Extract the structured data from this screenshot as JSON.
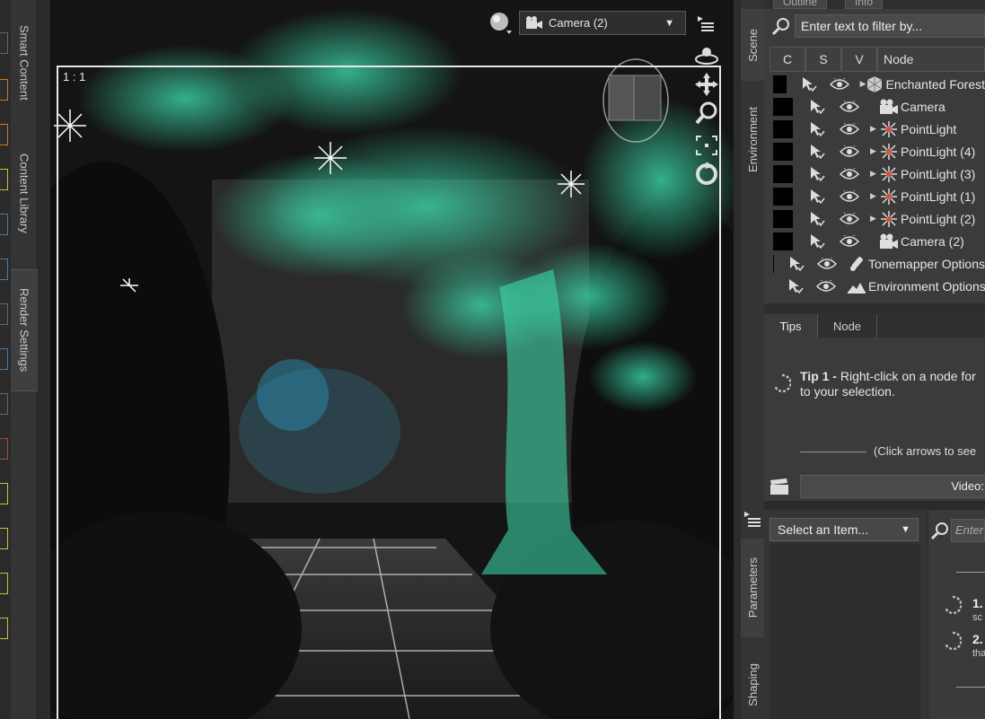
{
  "left_tabs": {
    "smart_content": "Smart Content",
    "content_library": "Content Library",
    "render_settings": "Render Settings"
  },
  "viewport": {
    "corner_label": "1 : 1",
    "camera_select": "Camera (2)",
    "colors": {
      "foliage": "#3ee0b0",
      "frame": "#e8e8e8"
    }
  },
  "right_tabs": {
    "scene": "Scene",
    "environment": "Environment",
    "parameters": "Parameters",
    "shaping": "Shaping"
  },
  "scene_panel": {
    "top_tabs": [
      "Outline",
      "Info"
    ],
    "filter_placeholder": "Enter text to filter by...",
    "columns": {
      "c": "C",
      "s": "S",
      "v": "V",
      "node": "Node"
    },
    "nodes": [
      {
        "name": "Enchanted Forest",
        "icon": "figure-icon",
        "expandable": true
      },
      {
        "name": "Camera",
        "icon": "camera-icon",
        "expandable": false
      },
      {
        "name": "PointLight",
        "icon": "pointlight-icon",
        "expandable": true
      },
      {
        "name": "PointLight (4)",
        "icon": "pointlight-icon",
        "expandable": true
      },
      {
        "name": "PointLight (3)",
        "icon": "pointlight-icon",
        "expandable": true
      },
      {
        "name": "PointLight (1)",
        "icon": "pointlight-icon",
        "expandable": true
      },
      {
        "name": "PointLight (2)",
        "icon": "pointlight-icon",
        "expandable": true
      },
      {
        "name": "Camera (2)",
        "icon": "camera-icon",
        "expandable": false
      },
      {
        "name": "Tonemapper Options",
        "icon": "tonemapper-icon",
        "expandable": false
      },
      {
        "name": "Environment Options",
        "icon": "environment-icon",
        "expandable": false
      }
    ]
  },
  "tips_panel": {
    "tabs": [
      "Tips",
      "Node"
    ],
    "tip_title": "Tip 1 -",
    "tip_text_line1": " Right-click on a node for",
    "tip_text_line2": "to your selection.",
    "nav_text": "(Click arrows to see",
    "video_label": "Video:"
  },
  "parameters_panel": {
    "select_item": "Select an Item...",
    "search_placeholder": "Enter",
    "items": [
      {
        "num": "1.",
        "sub": "sc"
      },
      {
        "num": "2.",
        "sub": "tha"
      }
    ]
  }
}
